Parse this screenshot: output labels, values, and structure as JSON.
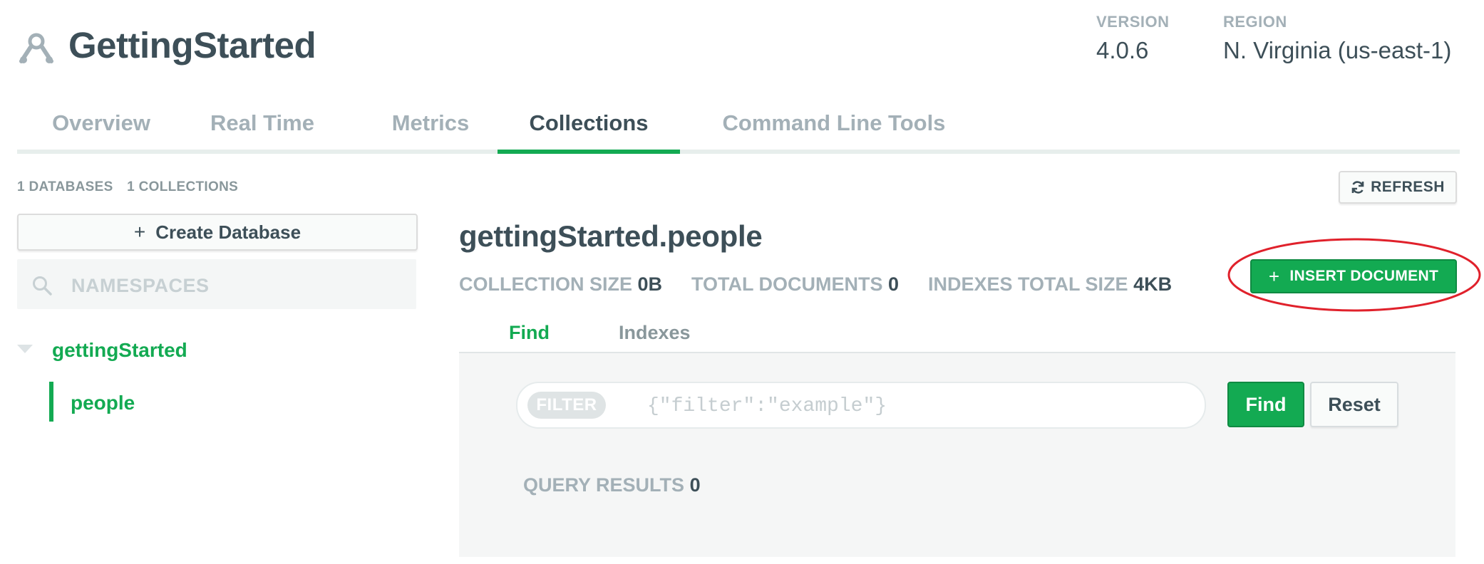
{
  "header": {
    "cluster_icon": "cluster-icon",
    "title": "GettingStarted",
    "version_label": "VERSION",
    "version_value": "4.0.6",
    "region_label": "REGION",
    "region_value": "N. Virginia (us-east-1)"
  },
  "tabs": [
    {
      "label": "Overview",
      "active": false
    },
    {
      "label": "Real Time",
      "active": false
    },
    {
      "label": "Metrics",
      "active": false
    },
    {
      "label": "Collections",
      "active": true
    },
    {
      "label": "Command Line Tools",
      "active": false
    }
  ],
  "counts": {
    "databases": "1 DATABASES",
    "collections": "1 COLLECTIONS"
  },
  "toolbar": {
    "refresh_icon": "refresh-icon",
    "refresh_label": "REFRESH"
  },
  "sidebar": {
    "create_db_label": "Create Database",
    "search_placeholder": "NAMESPACES",
    "databases": [
      {
        "name": "gettingStarted",
        "collections": [
          "people"
        ]
      }
    ]
  },
  "main": {
    "namespace": "gettingStarted.people",
    "stats": {
      "collection_size_label": "COLLECTION SIZE",
      "collection_size_value": "0B",
      "total_documents_label": "TOTAL DOCUMENTS",
      "total_documents_value": "0",
      "indexes_size_label": "INDEXES TOTAL SIZE",
      "indexes_size_value": "4KB"
    },
    "insert_label": "INSERT DOCUMENT",
    "subtabs": [
      {
        "label": "Find",
        "active": true
      },
      {
        "label": "Indexes",
        "active": false
      }
    ],
    "filter": {
      "pill_label": "FILTER",
      "placeholder": "{\"filter\":\"example\"}"
    },
    "find_label": "Find",
    "reset_label": "Reset",
    "query_results_label": "QUERY RESULTS",
    "query_results_value": "0"
  },
  "colors": {
    "accent_green": "#13aa52",
    "text_dark": "#3d4f58",
    "text_muted": "#a3b0b7",
    "annotation_red": "#e0212b"
  }
}
